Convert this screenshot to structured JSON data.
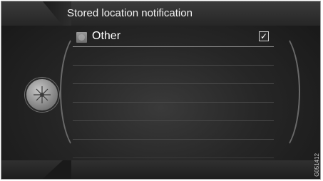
{
  "header": {
    "title": "Stored location notification"
  },
  "list": {
    "items": [
      {
        "label": "Other",
        "checked": true,
        "check_glyph": "✓",
        "icon": "category-icon"
      }
    ],
    "empty_rows": 6
  },
  "image_code": "G051412"
}
